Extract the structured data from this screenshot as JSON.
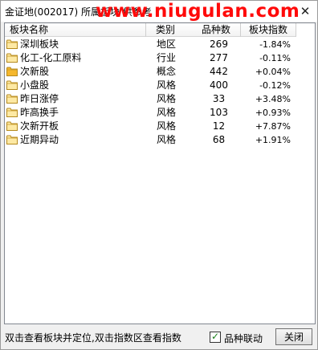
{
  "window": {
    "title": "金证地(002017)  所属板块   供参考",
    "watermark": "www.niugulan.com"
  },
  "table": {
    "columns": [
      "板块名称",
      "类别",
      "品种数",
      "板块指数"
    ],
    "rows": [
      {
        "name": "深圳板块",
        "category": "地区",
        "count": "269",
        "index": "-1.84%",
        "folder": "plain"
      },
      {
        "name": "化工-化工原料",
        "category": "行业",
        "count": "277",
        "index": "-0.11%",
        "folder": "plain"
      },
      {
        "name": "次新股",
        "category": "概念",
        "count": "442",
        "index": "+0.04%",
        "folder": "gold"
      },
      {
        "name": "小盘股",
        "category": "风格",
        "count": "400",
        "index": "-0.12%",
        "folder": "plain"
      },
      {
        "name": "昨日涨停",
        "category": "风格",
        "count": "33",
        "index": "+3.48%",
        "folder": "plain"
      },
      {
        "name": "昨高换手",
        "category": "风格",
        "count": "103",
        "index": "+0.93%",
        "folder": "plain"
      },
      {
        "name": "次新开板",
        "category": "风格",
        "count": "12",
        "index": "+7.87%",
        "folder": "plain"
      },
      {
        "name": "近期异动",
        "category": "风格",
        "count": "68",
        "index": "+1.91%",
        "folder": "plain"
      }
    ]
  },
  "footer": {
    "hint": "双击查看板块并定位,双击指数区查看指数",
    "checkbox_label": "品种联动",
    "checkbox_checked": true,
    "close_label": "关闭"
  },
  "icons": {
    "close": "close-icon",
    "folder": "folder-icon",
    "check": "checkmark-icon"
  },
  "colors": {
    "watermark": "#ff0a0a",
    "folder_plain": "#fde9a4",
    "folder_gold": "#f5b72d"
  }
}
